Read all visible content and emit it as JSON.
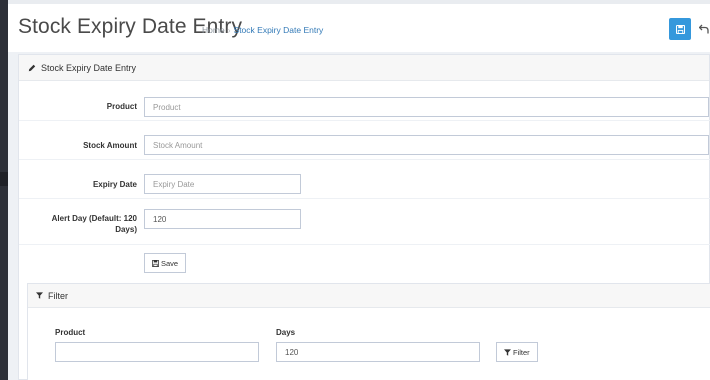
{
  "header": {
    "title": "Stock Expiry Date Entry",
    "breadcrumb_home": "Home",
    "breadcrumb_sep": "›",
    "breadcrumb_current": "Stock Expiry Date Entry"
  },
  "form": {
    "panel_title": "Stock Expiry Date Entry",
    "product_label": "Product",
    "product_placeholder": "Product",
    "stock_label": "Stock Amount",
    "stock_placeholder": "Stock Amount",
    "expiry_label": "Expiry Date",
    "expiry_placeholder": "Expiry Date",
    "alert_label_line1": "Alert Day (Default: 120",
    "alert_label_line2": "Days)",
    "alert_value": "120",
    "save_label": "Save"
  },
  "filter": {
    "title": "Filter",
    "product_label": "Product",
    "product_value": "",
    "days_label": "Days",
    "days_value": "120",
    "button_label": "Filter"
  },
  "colors": {
    "accent": "#3598dc",
    "link": "#337ab7",
    "sidebar": "#2d3038"
  },
  "icons": {
    "header_save": "floppy-disk-icon",
    "header_back": "undo-arrow-icon",
    "panel_title": "pencil-icon",
    "save_button": "floppy-disk-icon",
    "filter_title": "funnel-icon",
    "filter_button": "funnel-icon"
  }
}
